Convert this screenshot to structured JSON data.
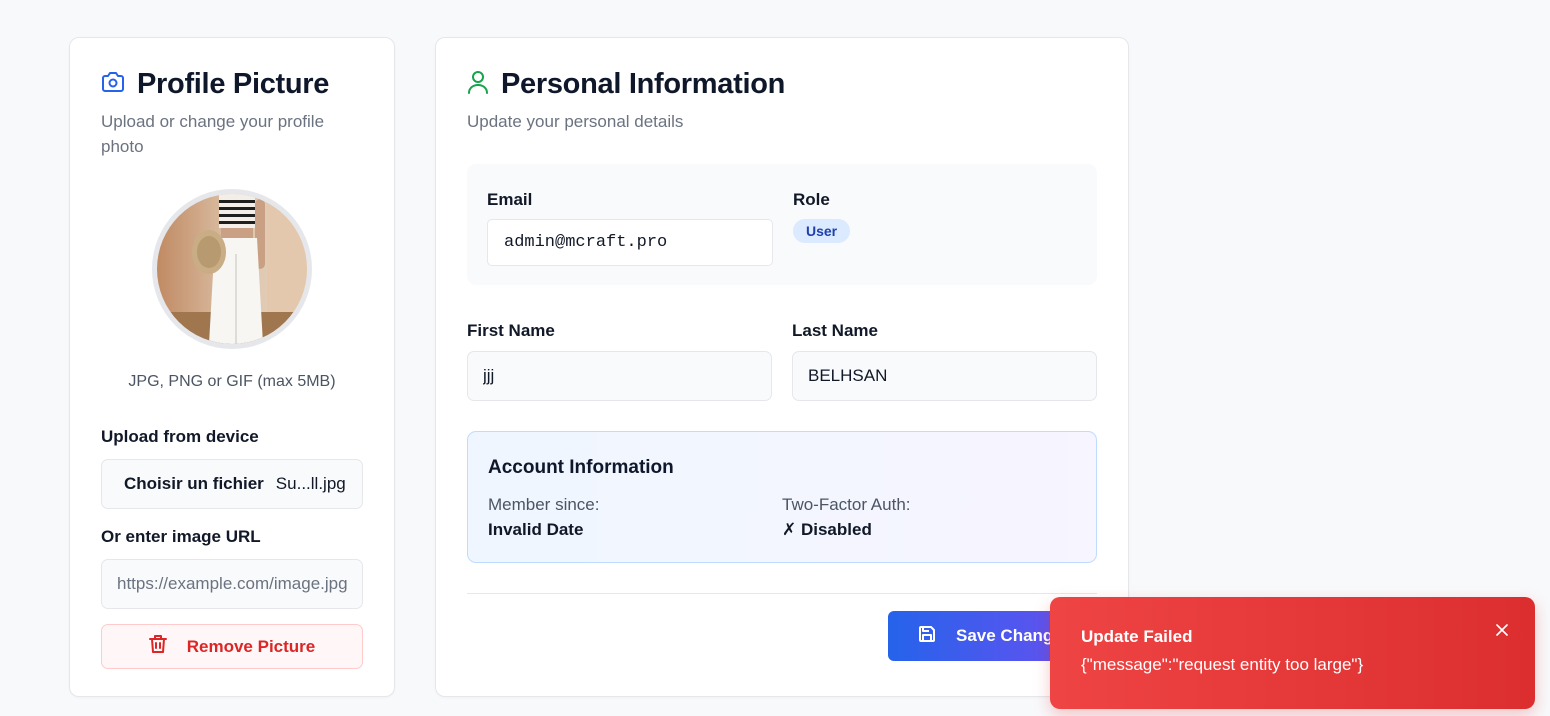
{
  "profile_card": {
    "title": "Profile Picture",
    "subtitle": "Upload or change your profile photo",
    "formats_hint": "JPG, PNG or GIF (max 5MB)",
    "upload_label": "Upload from device",
    "file_button": "Choisir un fichier",
    "file_name": "Su...ll.jpg",
    "url_label": "Or enter image URL",
    "url_placeholder": "https://example.com/image.jpg",
    "remove_button": "Remove Picture",
    "icon": "camera-icon"
  },
  "personal_card": {
    "title": "Personal Information",
    "subtitle": "Update your personal details",
    "icon": "user-icon",
    "email_label": "Email",
    "email_value": "admin@mcraft.pro",
    "role_label": "Role",
    "role_value": "User",
    "first_name_label": "First Name",
    "first_name_value": "jjj",
    "last_name_label": "Last Name",
    "last_name_value": "BELHSAN",
    "account": {
      "title": "Account Information",
      "member_since_label": "Member since:",
      "member_since_value": "Invalid Date",
      "two_factor_label": "Two-Factor Auth:",
      "two_factor_value": "✗ Disabled"
    },
    "save_button": "Save Changes"
  },
  "toast": {
    "title": "Update Failed",
    "message": "{\"message\":\"request entity too large\"}"
  },
  "colors": {
    "accent_blue": "#2563eb",
    "accent_green": "#16a34a",
    "danger": "#dc2626",
    "toast_bg": "#ef4444"
  }
}
